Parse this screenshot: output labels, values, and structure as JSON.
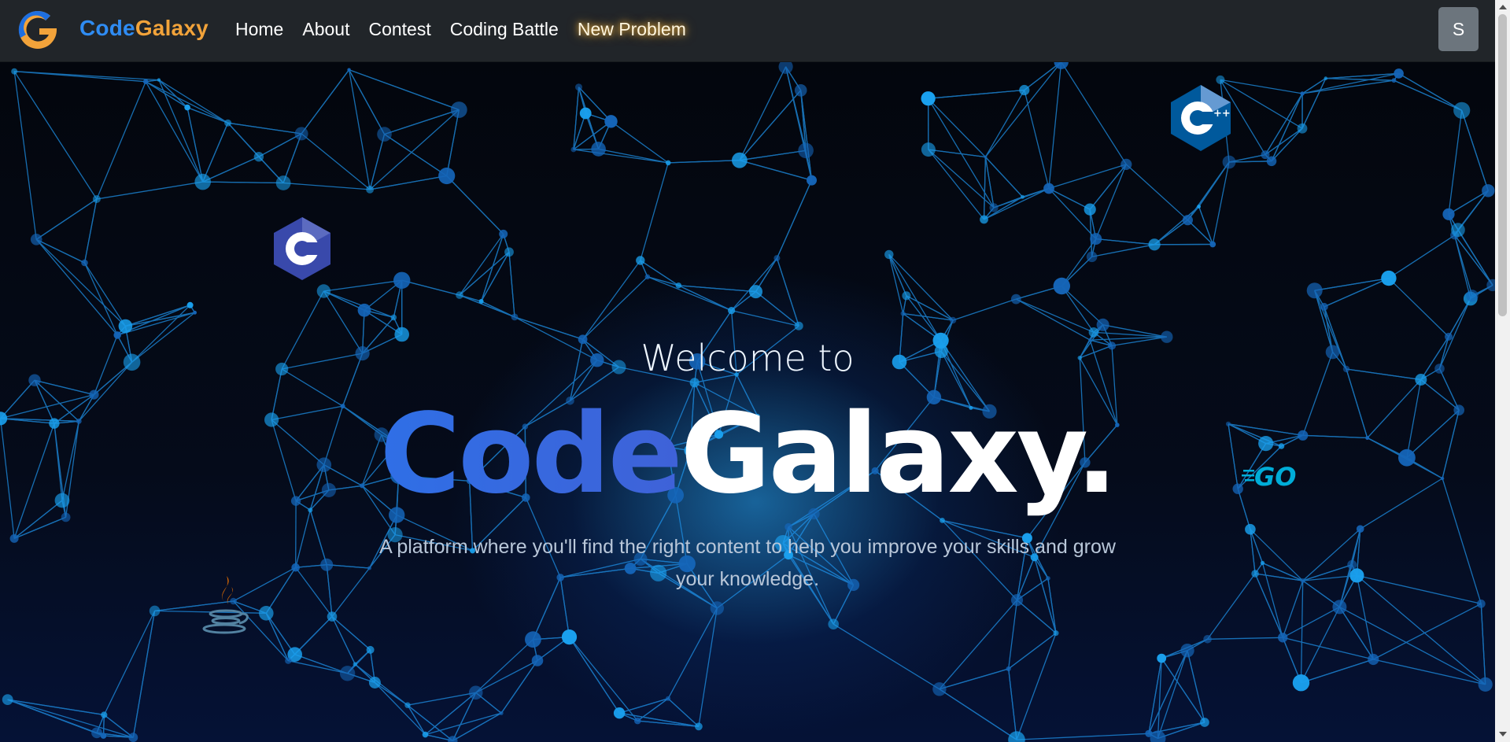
{
  "nav": {
    "brand_part1": "Code",
    "brand_part2": "Galaxy",
    "links": [
      "Home",
      "About",
      "Contest",
      "Coding Battle",
      "New Problem"
    ],
    "avatar_initial": "S"
  },
  "hero": {
    "welcome": "Welcome to",
    "title_part1": "Code",
    "title_part2": "Galaxy.",
    "tagline": "A platform where you'll find the right content to help you improve your skills and grow your knowledge."
  },
  "floating_icons": [
    "c-language-icon",
    "cpp-language-icon",
    "go-language-icon",
    "java-language-icon"
  ],
  "colors": {
    "navbar_bg": "#212529",
    "brand_blue": "#2f8cf3",
    "brand_orange": "#f2a33a",
    "avatar_bg": "#6c757d",
    "network_line": "#1e90e6"
  }
}
